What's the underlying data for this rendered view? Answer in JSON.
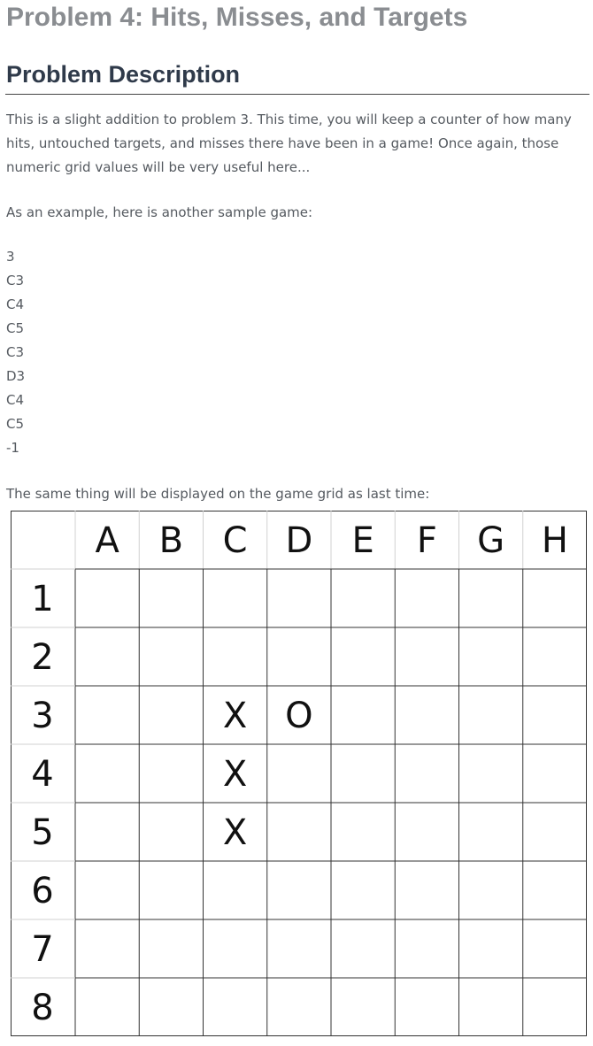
{
  "page": {
    "title": "Problem 4: Hits, Misses, and Targets"
  },
  "section": {
    "heading": "Problem Description"
  },
  "description": {
    "paragraph1": "This is a slight addition to problem 3. This time, you will keep a counter of how many hits, untouched targets, and misses there have been in a game! Once again, those numeric grid values will be very useful here...",
    "paragraph2": "As an example, here is another sample game:",
    "sample_input": [
      "3",
      "C3",
      "C4",
      "C5",
      "C3",
      "D3",
      "C4",
      "C5",
      "-1"
    ],
    "paragraph3": "The same thing will be displayed on the game grid as last time:"
  },
  "game_grid": {
    "columns": [
      "A",
      "B",
      "C",
      "D",
      "E",
      "F",
      "G",
      "H"
    ],
    "rows": [
      "1",
      "2",
      "3",
      "4",
      "5",
      "6",
      "7",
      "8"
    ],
    "marks": [
      {
        "col": "C",
        "row": "3",
        "symbol": "X"
      },
      {
        "col": "D",
        "row": "3",
        "symbol": "O"
      },
      {
        "col": "C",
        "row": "4",
        "symbol": "X"
      },
      {
        "col": "C",
        "row": "5",
        "symbol": "X"
      }
    ],
    "line_color": "#333333",
    "light_line_color": "#d0d0d0"
  }
}
